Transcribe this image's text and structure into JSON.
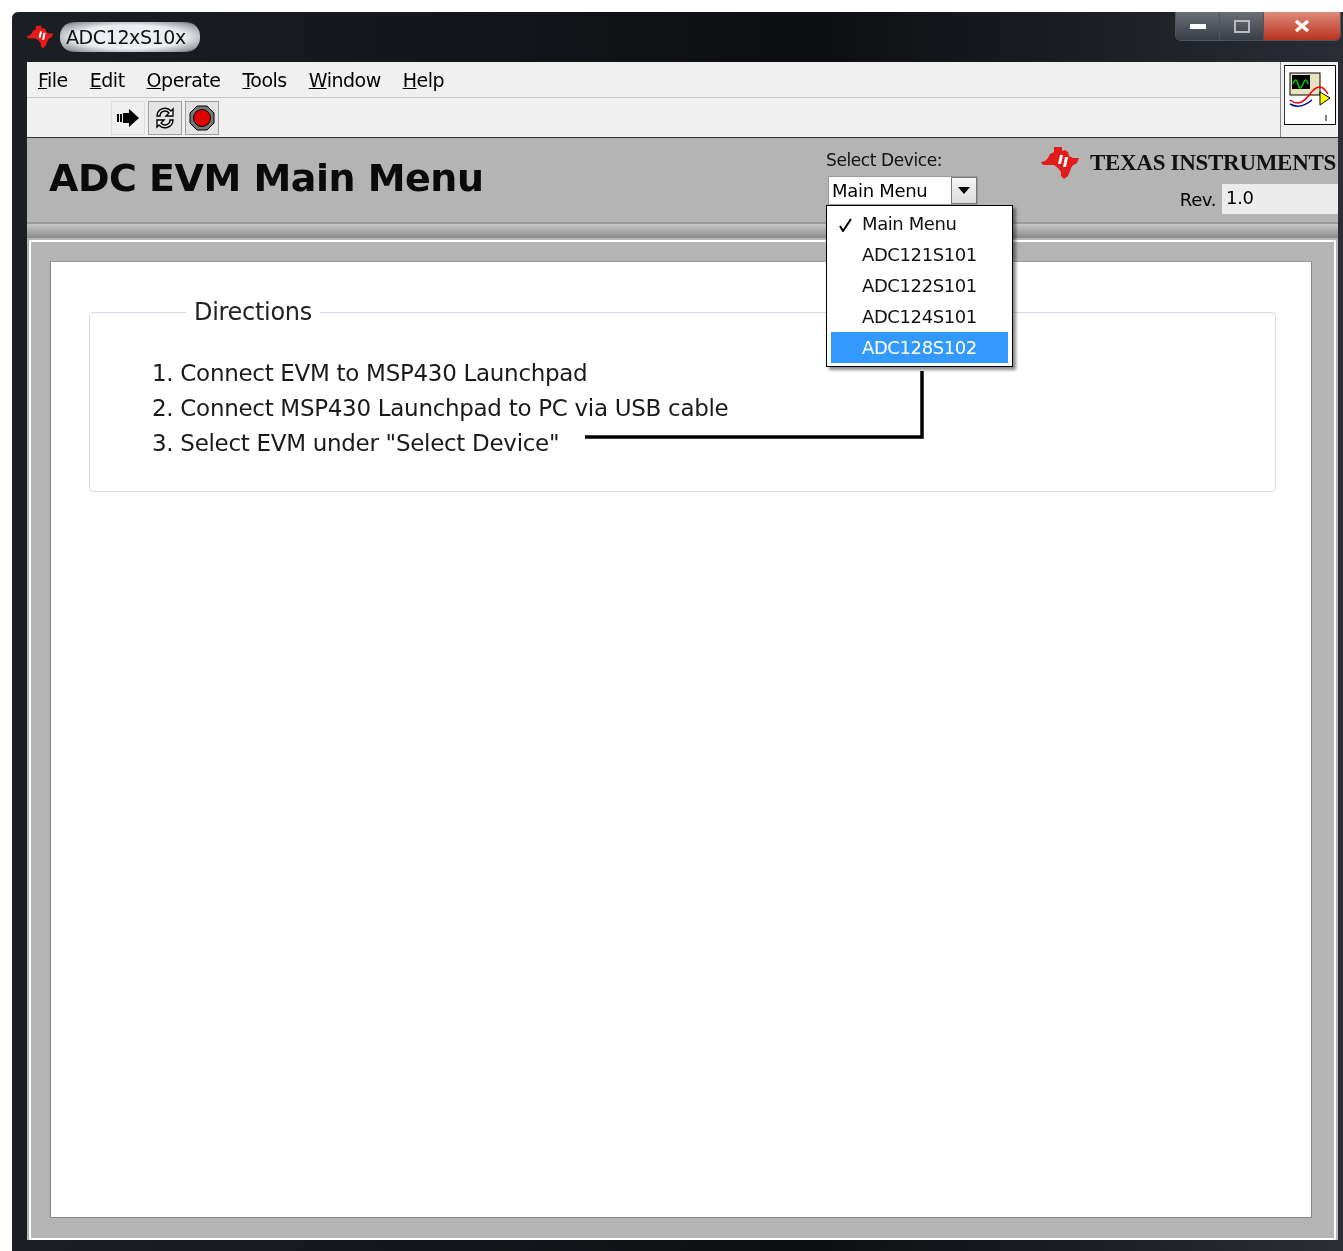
{
  "window": {
    "title": "ADC12xS10x"
  },
  "menu_bar": [
    {
      "label": "File"
    },
    {
      "label": "Edit"
    },
    {
      "label": "Operate"
    },
    {
      "label": "Tools"
    },
    {
      "label": "Window"
    },
    {
      "label": "Help"
    }
  ],
  "toolbar": [
    {
      "kind": "run"
    },
    {
      "kind": "run-continuous"
    },
    {
      "kind": "abort"
    }
  ],
  "header": {
    "title": "ADC EVM Main Menu",
    "select_device": {
      "label": "Select Device:",
      "value": "Main Menu",
      "expanded": true,
      "options": [
        {
          "label": "Main Menu",
          "checked": true,
          "highlighted": false
        },
        {
          "label": "ADC121S101",
          "checked": false,
          "highlighted": false
        },
        {
          "label": "ADC122S101",
          "checked": false,
          "highlighted": false
        },
        {
          "label": "ADC124S101",
          "checked": false,
          "highlighted": false
        },
        {
          "label": "ADC128S102",
          "checked": false,
          "highlighted": true
        }
      ]
    },
    "brand": "TEXAS INSTRUMENTS",
    "revision": {
      "label": "Rev.",
      "value": "1.0"
    }
  },
  "directions": {
    "title": "Directions",
    "steps": [
      "1. Connect EVM to MSP430 Launchpad",
      "2. Connect MSP430 Launchpad to PC via USB cable",
      "3. Select EVM under \"Select Device\""
    ]
  }
}
